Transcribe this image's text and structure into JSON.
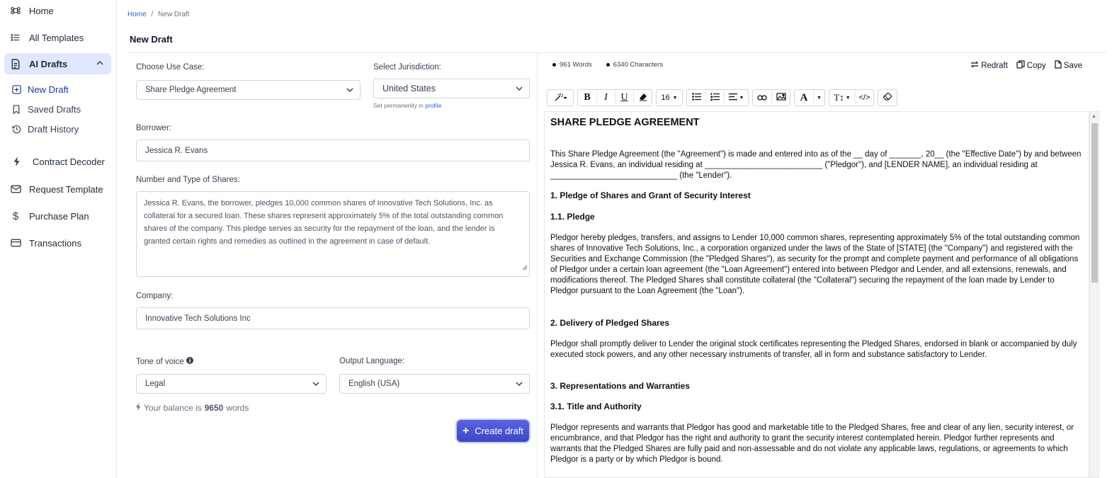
{
  "sidebar": {
    "home": "Home",
    "all_templates": "All Templates",
    "ai_drafts": "AI Drafts",
    "new_draft": "New Draft",
    "saved_drafts": "Saved Drafts",
    "draft_history": "Draft History",
    "contract_decoder": "Contract Decoder",
    "request_template": "Request Template",
    "purchase_plan": "Purchase Plan",
    "transactions": "Transactions"
  },
  "breadcrumb": {
    "home": "Home",
    "separator": "/",
    "current": "New Draft"
  },
  "page_title": "New Draft",
  "form": {
    "use_case_label": "Choose Use Case:",
    "use_case_value": "Share Pledge Agreement",
    "jurisdiction_label": "Select Jurisdiction:",
    "jurisdiction_value": "United States",
    "jurisdiction_hint": "Set permanently in",
    "jurisdiction_hint_link": "profile",
    "borrower_label": "Borrower:",
    "borrower_value": "Jessica R. Evans",
    "shares_label": "Number and Type of Shares:",
    "shares_value": "Jessica R. Evans, the borrower, pledges 10,000 common shares of Innovative Tech Solutions, Inc. as collateral for a secured loan. These shares represent approximately 5% of the total outstanding common shares of the company. This pledge serves as security for the repayment of the loan, and the lender is granted certain rights and remedies as outlined in the agreement in case of default.",
    "company_label": "Company:",
    "company_value": "Innovative Tech Solutions Inc",
    "tone_label": "Tone of voice",
    "tone_value": "Legal",
    "language_label": "Output Language:",
    "language_value": "English (USA)",
    "balance_prefix": "Your balance is",
    "balance_amount": "9650",
    "balance_suffix": "words",
    "create_button": "Create draft"
  },
  "editor": {
    "words": "961 Words",
    "characters": "6340 Characters",
    "redraft": "Redraft",
    "copy": "Copy",
    "save": "Save",
    "font_size": "16",
    "doc": {
      "title": "SHARE PLEDGE AGREEMENT",
      "intro": "This Share Pledge Agreement (the \"Agreement\") is made and entered into as of the __ day of _______, 20__ (the \"Effective Date\") by and between Jessica R. Evans, an individual residing at __________________________ (\"Pledgor\"), and [LENDER NAME], an individual residing at ____________________________ (the \"Lender\").",
      "s1": "1. Pledge of Shares and Grant of Security Interest",
      "s1_1": "1.1. Pledge",
      "p1": "Pledgor hereby pledges, transfers, and assigns to Lender 10,000 common shares, representing approximately 5% of the total outstanding common shares of Innovative Tech Solutions, Inc., a corporation organized under the laws of the State of [STATE] (the \"Company\") and registered with the Securities and Exchange Commission (the \"Pledged Shares\"), as security for the prompt and complete payment and performance of all obligations of Pledgor under a certain loan agreement (the \"Loan Agreement\") entered into between Pledgor and Lender, and all extensions, renewals, and modifications thereof. The Pledged Shares shall constitute collateral (the \"Collateral\") securing the repayment of the loan made by Lender to Pledgor pursuant to the Loan Agreement (the \"Loan\").",
      "s2": "2. Delivery of Pledged Shares",
      "p2": "Pledgor shall promptly deliver to Lender the original stock certificates representing the Pledged Shares, endorsed in blank or accompanied by duly executed stock powers, and any other necessary instruments of transfer, all in form and substance satisfactory to Lender.",
      "s3": "3. Representations and Warranties",
      "s3_1": "3.1. Title and Authority",
      "p3": "Pledgor represents and warrants that Pledgor has good and marketable title to the Pledged Shares, free and clear of any lien, security interest, or encumbrance, and that Pledgor has the right and authority to grant the security interest contemplated herein. Pledgor further represents and warrants that the Pledged Shares are fully paid and non-assessable and do not violate any applicable laws, regulations, or agreements to which Pledgor is a party or by which Pledgor is bound."
    }
  }
}
